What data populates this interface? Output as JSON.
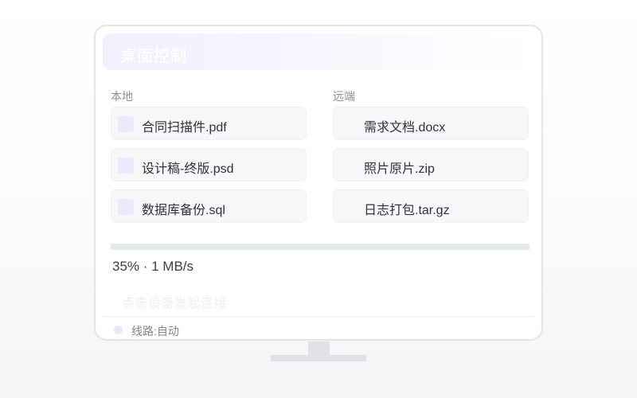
{
  "window": {
    "title": "桌面控制"
  },
  "local": {
    "label": "本地",
    "files": [
      {
        "name": "合同扫描件.pdf"
      },
      {
        "name": "设计稿-终版.psd"
      },
      {
        "name": "数据库备份.sql"
      }
    ]
  },
  "remote": {
    "label": "远端",
    "files": [
      {
        "name": "需求文档.docx"
      },
      {
        "name": "照片原片.zip"
      },
      {
        "name": "日志打包.tar.gz"
      }
    ]
  },
  "transfer": {
    "progress_percent": 35,
    "status_text": "35% · 1 MB/s"
  },
  "hint": "点击设备发起连接",
  "status": {
    "route_label": "线路:自动"
  },
  "colors": {
    "accent_light": "#ede9fb",
    "progress_track": "#e5e8ed",
    "card_bg": "#f6f7f9"
  },
  "icons": {
    "file": "file-icon",
    "status": "status-dot"
  }
}
